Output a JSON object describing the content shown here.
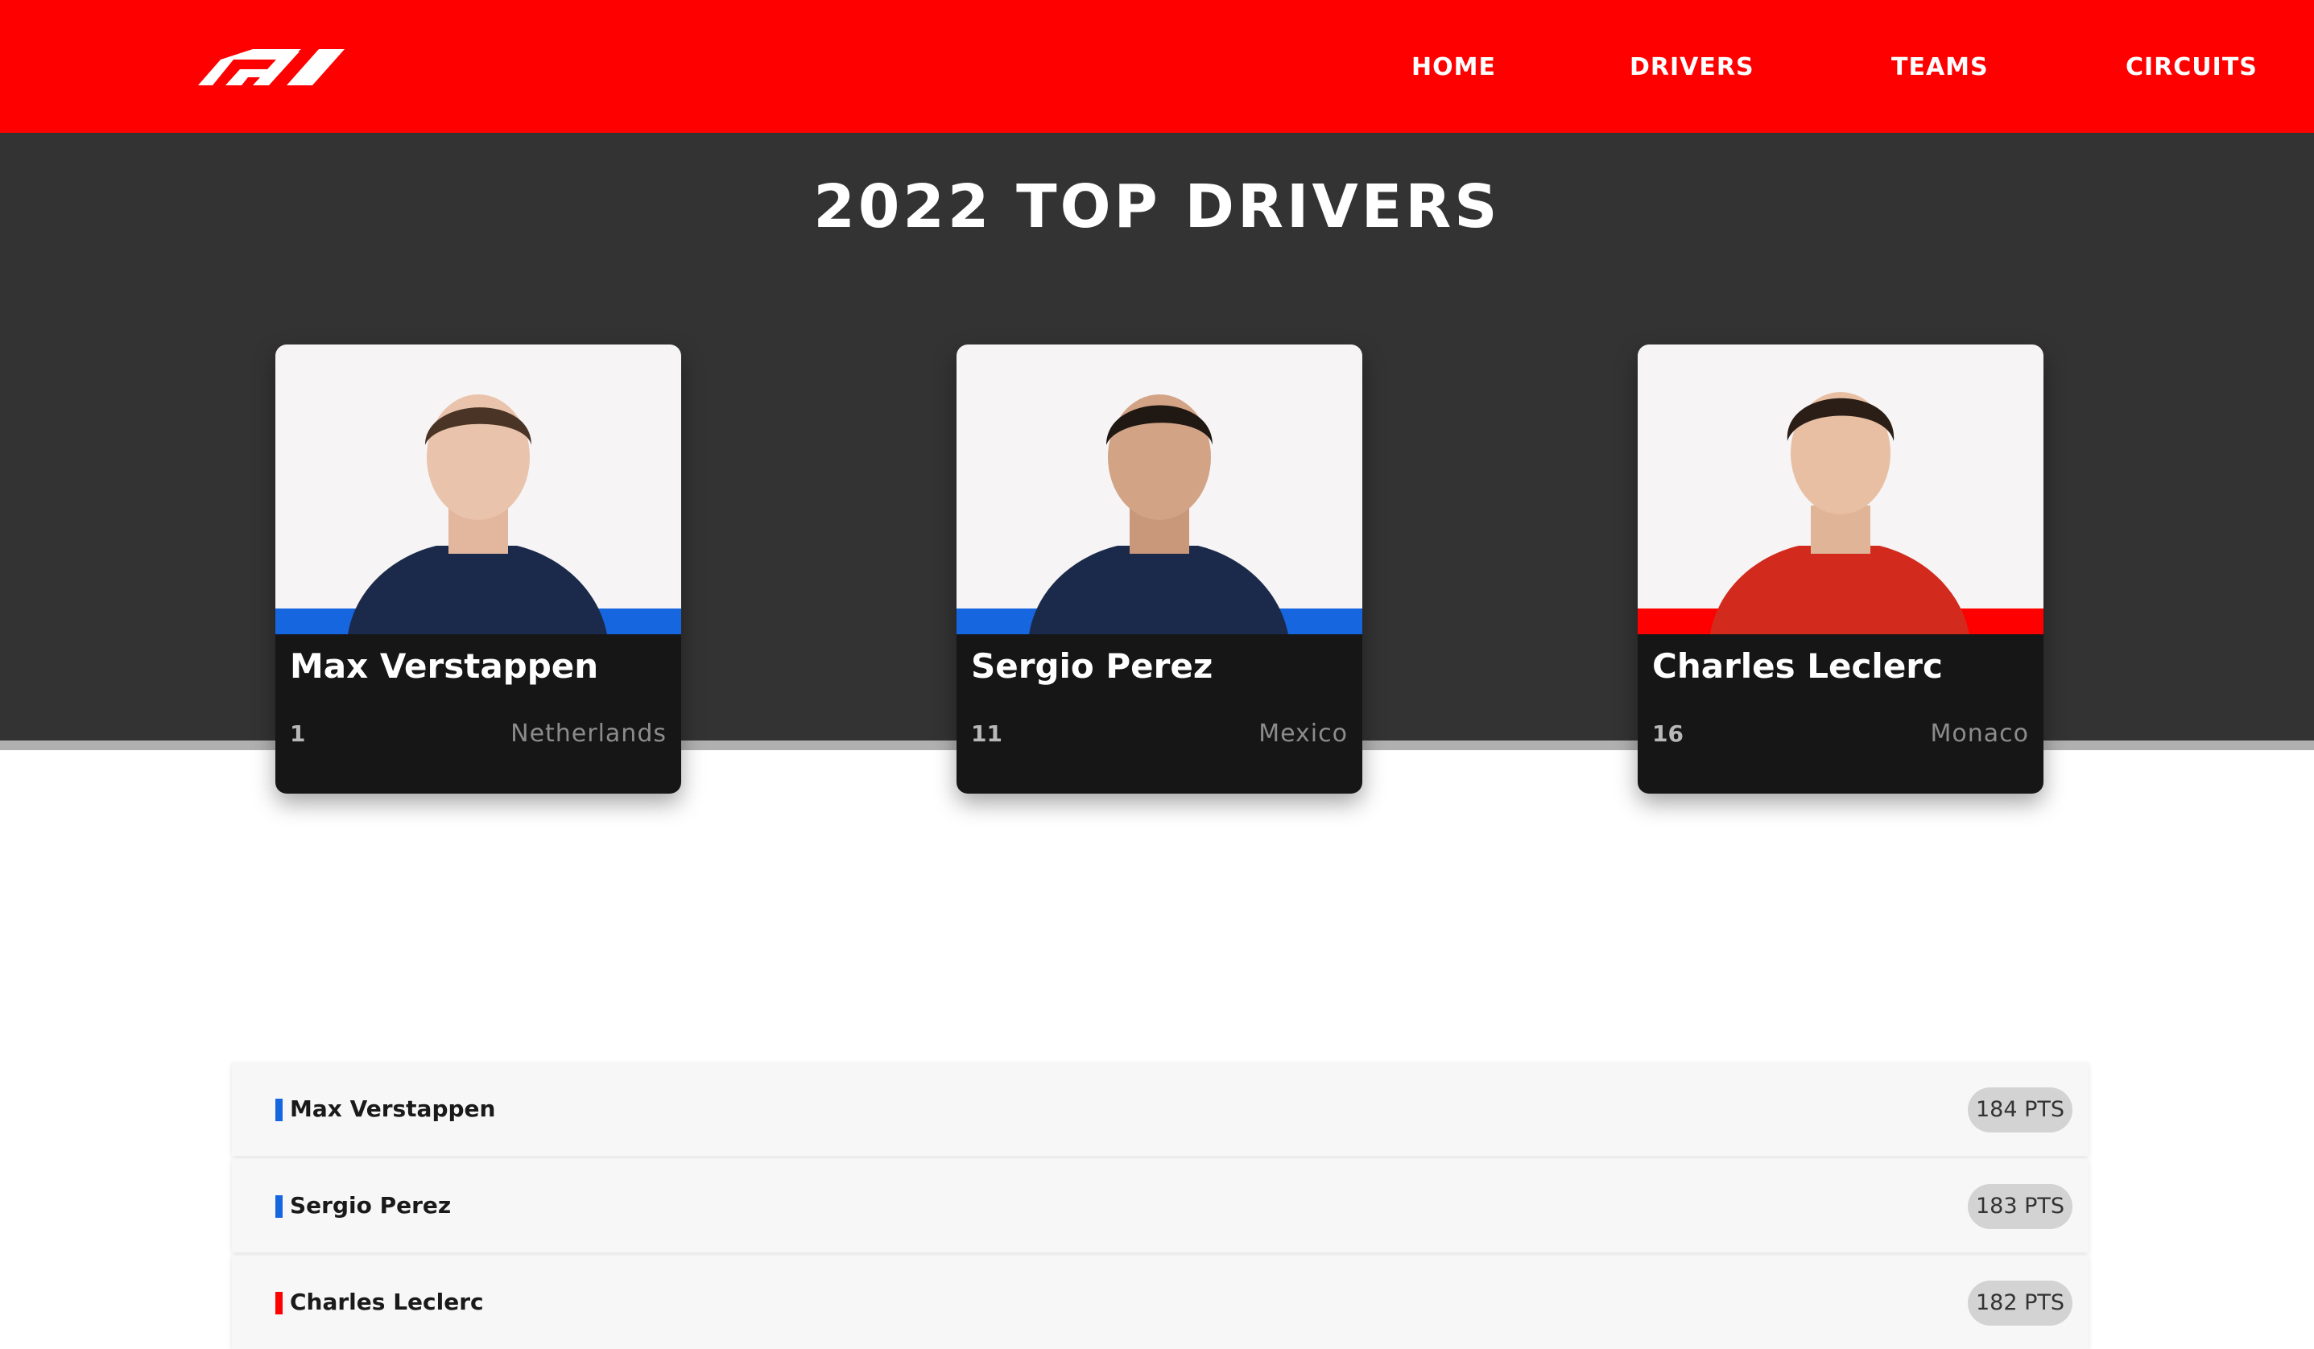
{
  "navbar": {
    "logo_text": "F1",
    "links": [
      "HOME",
      "DRIVERS",
      "TEAMS",
      "CIRCUITS"
    ],
    "background_color": "#ff0000"
  },
  "hero": {
    "title": "2022 TOP DRIVERS",
    "background_color": "#333333"
  },
  "drivers": [
    {
      "name": "Max Verstappen",
      "number": "1",
      "country": "Netherlands",
      "team_color": "#1666e0",
      "suit_color": "#1b2a4a"
    },
    {
      "name": "Sergio Perez",
      "number": "11",
      "country": "Mexico",
      "team_color": "#1666e0",
      "suit_color": "#1b2a4a"
    },
    {
      "name": "Charles Leclerc",
      "number": "16",
      "country": "Monaco",
      "team_color": "#ff0000",
      "suit_color": "#d32a1e"
    }
  ],
  "standings": [
    {
      "name": "Max Verstappen",
      "points": "184 PTS",
      "team_color": "#1666e0"
    },
    {
      "name": "Sergio Perez",
      "points": "183 PTS",
      "team_color": "#1666e0"
    },
    {
      "name": "Charles Leclerc",
      "points": "182 PTS",
      "team_color": "#ff0000"
    }
  ]
}
